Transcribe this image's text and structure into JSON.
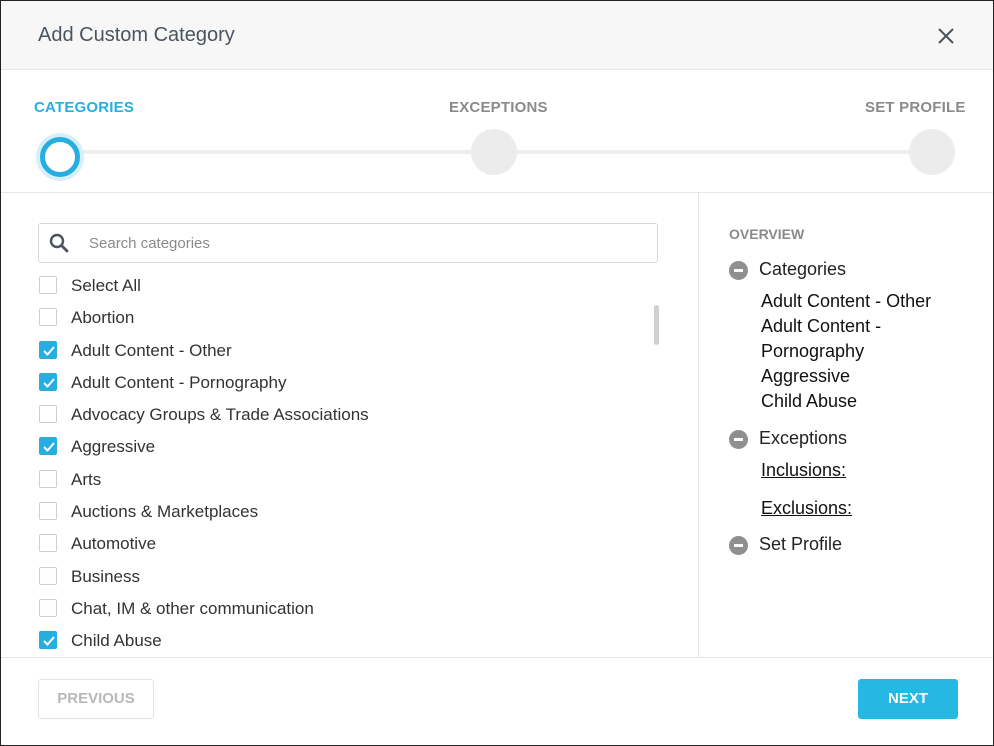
{
  "dialog": {
    "title": "Add Custom Category"
  },
  "stepper": {
    "steps": [
      {
        "label": "CATEGORIES",
        "active": true
      },
      {
        "label": "EXCEPTIONS",
        "active": false
      },
      {
        "label": "SET PROFILE",
        "active": false
      }
    ]
  },
  "search": {
    "placeholder": "Search categories",
    "value": ""
  },
  "categories": [
    {
      "label": "Select All",
      "checked": false
    },
    {
      "label": "Abortion",
      "checked": false
    },
    {
      "label": "Adult Content - Other",
      "checked": true
    },
    {
      "label": "Adult Content - Pornography",
      "checked": true
    },
    {
      "label": "Advocacy Groups & Trade Associations",
      "checked": false
    },
    {
      "label": "Aggressive",
      "checked": true
    },
    {
      "label": "Arts",
      "checked": false
    },
    {
      "label": "Auctions & Marketplaces",
      "checked": false
    },
    {
      "label": "Automotive",
      "checked": false
    },
    {
      "label": "Business",
      "checked": false
    },
    {
      "label": "Chat, IM & other communication",
      "checked": false
    },
    {
      "label": "Child Abuse",
      "checked": true
    }
  ],
  "overview": {
    "title": "OVERVIEW",
    "categories_label": "Categories",
    "selected": [
      "Adult Content - Other",
      "Adult Content -",
      "Pornography",
      "Aggressive",
      "Child Abuse"
    ],
    "exceptions_label": "Exceptions",
    "inclusions_label": "Inclusions:",
    "exclusions_label": "Exclusions:",
    "set_profile_label": "Set Profile"
  },
  "footer": {
    "previous_label": "PREVIOUS",
    "next_label": "NEXT"
  },
  "colors": {
    "accent": "#27aee0",
    "next_button": "#27b7e3",
    "muted": "#8a8a8a"
  },
  "icons": {
    "close": "close-icon",
    "search": "search-icon",
    "check": "check-icon",
    "collapse": "minus-circle-icon"
  }
}
